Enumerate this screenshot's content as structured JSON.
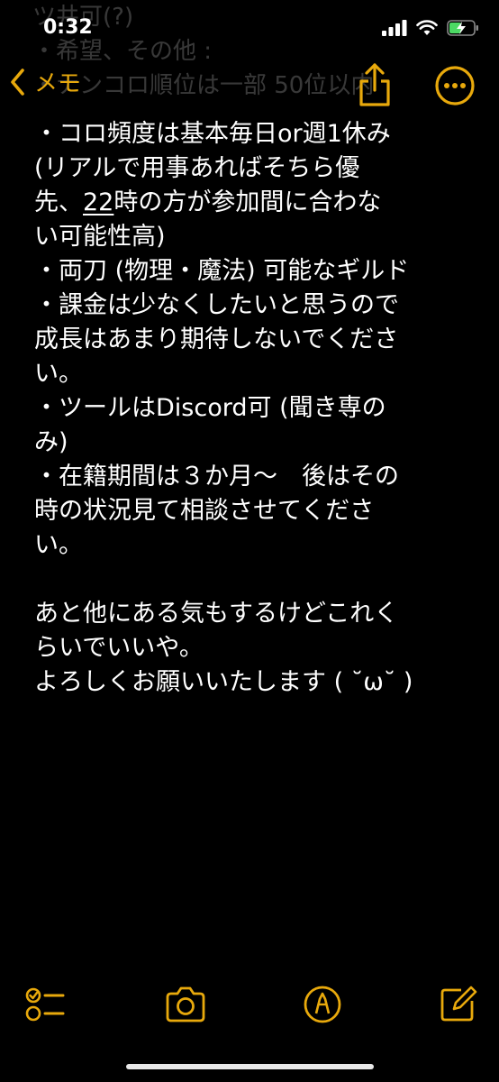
{
  "status_bar": {
    "time": "0:32"
  },
  "nav": {
    "back_label": "メモ"
  },
  "ghost_lines": [
    "ツ井可(?)",
    "・希望、その他 :",
    "・ナンコロ順位は一部 50位以内"
  ],
  "note": {
    "lines": [
      "・コロ頻度は基本毎日or週1休み",
      "(リアルで用事あればそちら優",
      "",
      "い可能性高)",
      "・両刀 (物理・魔法) 可能なギルド",
      "・課金は少なくしたいと思うので",
      "成長はあまり期待しないでくださ",
      "い。",
      "・ツールはDiscord可 (聞き専の",
      "み)",
      "・在籍期間は３か月～　後はその",
      "時の状況見て相談させてくださ",
      "い。",
      "",
      "あと他にある気もするけどこれく",
      "らいでいいや。",
      "よろしくお願いいたします ( ˘ω˘ )"
    ],
    "line3_prefix": "先、",
    "line3_underlined": "22",
    "line3_suffix": "時の方が参加間に合わな"
  },
  "colors": {
    "accent": "#e8a90c",
    "background": "#000000",
    "text": "#ffffff"
  },
  "icons": {
    "battery": "battery-charging-icon",
    "wifi": "wifi-icon",
    "signal": "signal-icon",
    "share": "share-icon",
    "more": "more-icon",
    "checklist": "checklist-icon",
    "camera": "camera-icon",
    "markup": "markup-icon",
    "compose": "compose-icon"
  }
}
